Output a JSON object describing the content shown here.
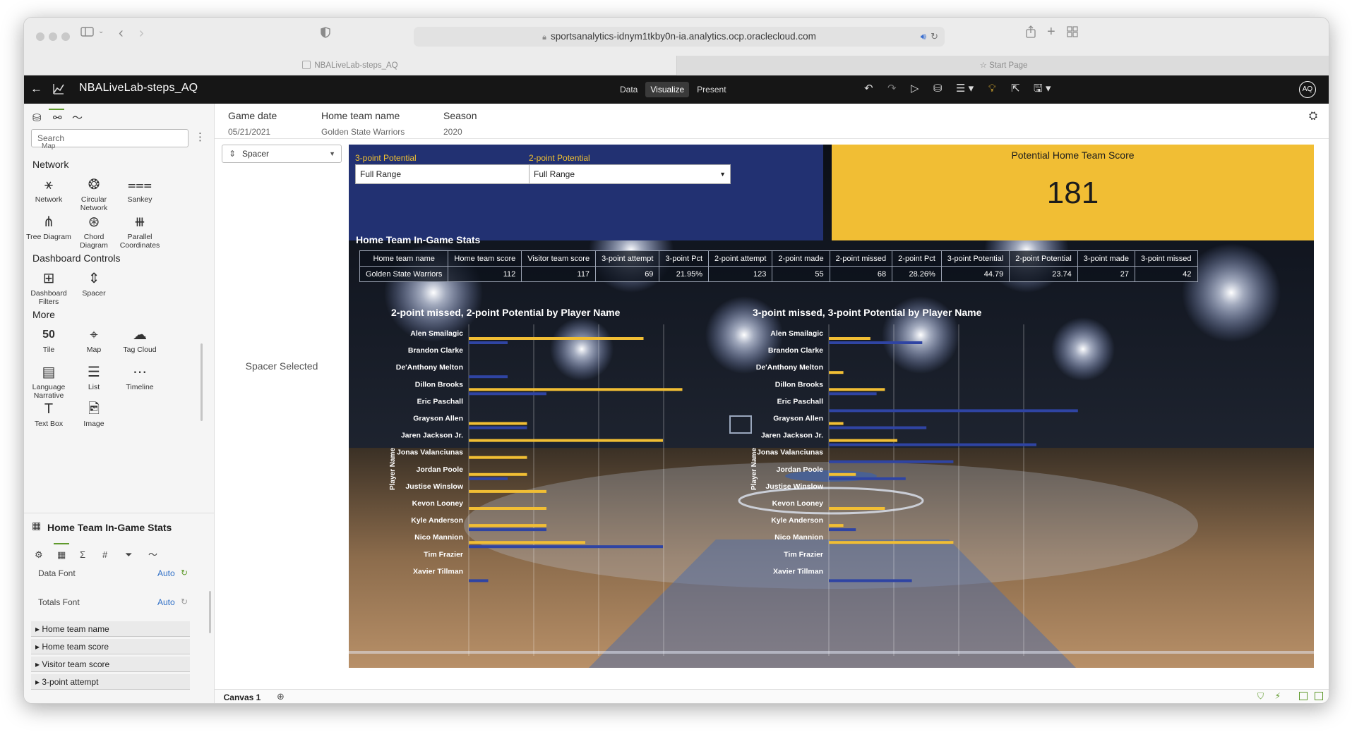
{
  "browser": {
    "url": "sportsanalytics-idnym1tkby0n-ia.analytics.ocp.oraclecloud.com",
    "tabs": [
      {
        "label": "NBALiveLab-steps_AQ"
      },
      {
        "label": "Start Page"
      }
    ]
  },
  "app": {
    "title": "NBALiveLab-steps_AQ",
    "modes": [
      "Data",
      "Visualize",
      "Present"
    ],
    "active_mode": "Visualize",
    "user_initials": "AQ"
  },
  "sidebar": {
    "search_placeholder": "Search",
    "partial_item": "Map",
    "sections": [
      {
        "title": "Network",
        "items": [
          {
            "label": "Network",
            "icon": "network-icon"
          },
          {
            "label": "Circular Network",
            "icon": "circular-network-icon"
          },
          {
            "label": "Sankey",
            "icon": "sankey-icon"
          },
          {
            "label": "Tree Diagram",
            "icon": "tree-diagram-icon"
          },
          {
            "label": "Chord Diagram",
            "icon": "chord-diagram-icon"
          },
          {
            "label": "Parallel Coordinates",
            "icon": "parallel-coordinates-icon"
          }
        ]
      },
      {
        "title": "Dashboard Controls",
        "items": [
          {
            "label": "Dashboard Filters",
            "icon": "dashboard-filters-icon"
          },
          {
            "label": "Spacer",
            "icon": "spacer-icon"
          }
        ]
      },
      {
        "title": "More",
        "items": [
          {
            "label": "Tile",
            "icon": "tile-icon",
            "glyph": "50"
          },
          {
            "label": "Map",
            "icon": "map-icon"
          },
          {
            "label": "Tag Cloud",
            "icon": "tag-cloud-icon"
          },
          {
            "label": "Language Narrative",
            "icon": "language-narrative-icon"
          },
          {
            "label": "List",
            "icon": "list-icon"
          },
          {
            "label": "Timeline",
            "icon": "timeline-icon"
          },
          {
            "label": "Text Box",
            "icon": "text-box-icon",
            "glyph": "T"
          },
          {
            "label": "Image",
            "icon": "image-icon"
          }
        ]
      }
    ],
    "properties": {
      "title": "Home Team In-Game Stats",
      "rows": [
        {
          "label": "Data Font",
          "value": "Auto"
        },
        {
          "label": "Totals Font",
          "value": "Auto"
        }
      ],
      "fields": [
        "Home team name",
        "Home team score",
        "Visitor team score",
        "3-point attempt"
      ]
    }
  },
  "canvas": {
    "header": [
      {
        "label": "Game date",
        "value": "05/21/2021"
      },
      {
        "label": "Home team name",
        "value": "Golden State Warriors"
      },
      {
        "label": "Season",
        "value": "2020"
      }
    ],
    "spacer_dropdown": "Spacer",
    "spacer_selected_text": "Spacer Selected",
    "filters": [
      {
        "label": "3-point Potential",
        "value": "Full Range"
      },
      {
        "label": "2-point Potential",
        "value": "Full Range"
      }
    ],
    "tile": {
      "title": "Potential Home Team Score",
      "value": "181"
    },
    "table": {
      "title": "Home Team In-Game Stats",
      "headers": [
        "Home team name",
        "Home team score",
        "Visitor team score",
        "3-point attempt",
        "3-point Pct",
        "2-point attempt",
        "2-point made",
        "2-point missed",
        "2-point Pct",
        "3-point Potential",
        "2-point Potential",
        "3-point made",
        "3-point missed"
      ],
      "rows": [
        [
          "Golden State Warriors",
          "112",
          "117",
          "69",
          "21.95%",
          "123",
          "55",
          "68",
          "28.26%",
          "44.79",
          "23.74",
          "27",
          "42"
        ]
      ]
    },
    "tab_label": "Canvas 1"
  },
  "colors": {
    "navy": "#223172",
    "gold": "#f1be34",
    "bar_gold": "#f1be34",
    "bar_blue": "#2f44a3",
    "accent_green": "#5f9a2c"
  },
  "chart_data": [
    {
      "type": "bar",
      "title": "2-point missed, 2-point Potential by Player Name",
      "ylabel": "Player Name",
      "categories": [
        "Alen Smailagic",
        "Brandon Clarke",
        "De'Anthony Melton",
        "Dillon Brooks",
        "Eric Paschall",
        "Grayson Allen",
        "Jaren Jackson Jr.",
        "Jonas Valanciunas",
        "Jordan Poole",
        "Justise Winslow",
        "Kevon Looney",
        "Kyle Anderson",
        "Nico Mannion",
        "Tim Frazier",
        "Xavier Tillman"
      ],
      "series": [
        {
          "name": "2-point missed",
          "color": "#f1be34",
          "values": [
            9,
            0,
            0,
            11,
            0,
            3,
            10,
            3,
            3,
            4,
            4,
            4,
            6,
            0,
            0
          ]
        },
        {
          "name": "2-point Potential",
          "color": "#2f44a3",
          "values": [
            2,
            0,
            2,
            4,
            0,
            3,
            0,
            0,
            2,
            0,
            0,
            4,
            10,
            0,
            1
          ]
        }
      ]
    },
    {
      "type": "bar",
      "title": "3-point missed, 3-point Potential by Player Name",
      "ylabel": "Player Name",
      "categories": [
        "Alen Smailagic",
        "Brandon Clarke",
        "De'Anthony Melton",
        "Dillon Brooks",
        "Eric Paschall",
        "Grayson Allen",
        "Jaren Jackson Jr.",
        "Jonas Valanciunas",
        "Jordan Poole",
        "Justise Winslow",
        "Kevon Looney",
        "Kyle Anderson",
        "Nico Mannion",
        "Tim Frazier",
        "Xavier Tillman"
      ],
      "series": [
        {
          "name": "3-point missed",
          "color": "#f1be34",
          "values": [
            2,
            0,
            0.7,
            2.7,
            0,
            0.7,
            3.3,
            0,
            1.3,
            0,
            2.7,
            0.7,
            6,
            0,
            0
          ]
        },
        {
          "name": "3-point Potential",
          "color": "#2f44a3",
          "values": [
            4.5,
            0,
            0,
            2.3,
            12,
            4.7,
            10,
            6,
            3.7,
            0,
            0,
            1.3,
            0,
            0,
            4
          ]
        }
      ]
    }
  ]
}
